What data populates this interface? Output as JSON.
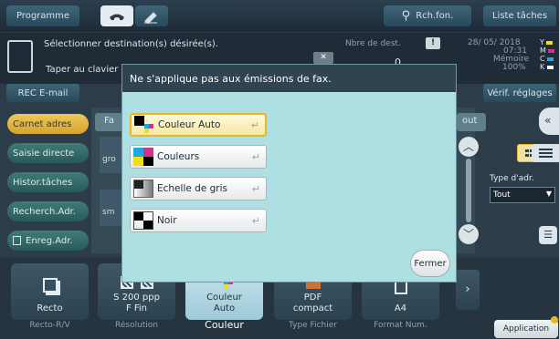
{
  "topbar": {
    "programme": "Programme",
    "search": "Rch.fon.",
    "job_list": "Liste tâches"
  },
  "info": {
    "prompt": "Sélectionner destination(s) désirée(s).",
    "input_hint": "Taper au clavier",
    "dest_count_label": "Nbre de dest.",
    "dest_count": "0",
    "date": "28/ 05/ 2018",
    "time": "07:31",
    "memory_label": "Mémoire",
    "memory": "100%",
    "toner": [
      "Y",
      "M",
      "C",
      "K"
    ]
  },
  "tabs": {
    "rec_email": "REC E-mail",
    "verify": "Vérif. réglages"
  },
  "left_menu": [
    {
      "label": "Carnet adres",
      "active": true
    },
    {
      "label": "Saisie directe",
      "active": false
    },
    {
      "label": "Histor.tâches",
      "active": false
    },
    {
      "label": "Recherch.Adr.",
      "active": false
    },
    {
      "label": "Enreg.Adr.",
      "active": false
    }
  ],
  "content": {
    "partial_tab": "Fa",
    "partial_tab2": "out",
    "item1": "gro",
    "item2": "sm",
    "type_label": "Type d'adr.",
    "type_value": "Tout"
  },
  "modal": {
    "header": "Ne s'applique pas aux émissions de fax.",
    "options": [
      {
        "label": "Couleur Auto",
        "icon": "auto-color-icon",
        "selected": true
      },
      {
        "label": "Couleurs",
        "icon": "full-color-icon",
        "selected": false
      },
      {
        "label": "Echelle de gris",
        "icon": "grayscale-icon",
        "selected": false
      },
      {
        "label": "Noir",
        "icon": "black-icon",
        "selected": false
      }
    ],
    "enter_symbol": "↵",
    "close": "Fermer"
  },
  "bottom": [
    {
      "value": "Recto",
      "label": "Recto-R/V",
      "icon": "duplex-icon",
      "selected": false
    },
    {
      "value": "S 200 ppp\nF Fin",
      "label": "Résolution",
      "icon": "resolution-icon",
      "selected": false
    },
    {
      "value": "Couleur\nAuto",
      "label": "Couleur",
      "icon": "color-icon",
      "selected": true
    },
    {
      "value": "PDF\ncompact",
      "label": "Type Fichier",
      "icon": "pdf-icon",
      "selected": false
    },
    {
      "value": "A4",
      "label": "Format Num.",
      "icon": "paper-icon",
      "selected": false
    }
  ],
  "application": "Application",
  "colors": {
    "accent": "#e8b820",
    "modal_bg": "#aee0e3",
    "header_bg": "#2f4350"
  }
}
